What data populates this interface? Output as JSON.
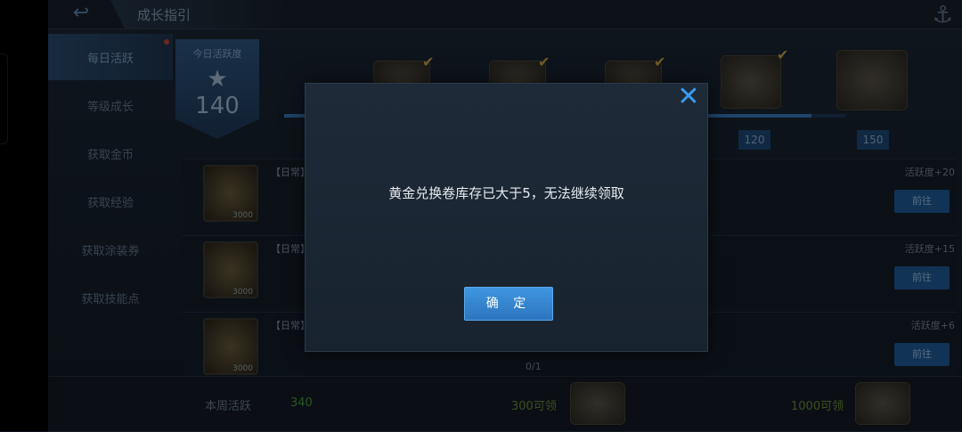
{
  "header": {
    "title": "成长指引",
    "back_icon": "back-arrow-icon",
    "anchor_icon": "anchor-icon"
  },
  "sidebar": {
    "items": [
      {
        "label": "每日活跃",
        "active": true,
        "has_dot": true
      },
      {
        "label": "等级成长",
        "active": false
      },
      {
        "label": "获取金币",
        "active": false
      },
      {
        "label": "获取经验",
        "active": false
      },
      {
        "label": "获取涂装券",
        "active": false
      },
      {
        "label": "获取技能点",
        "active": false
      }
    ]
  },
  "activity": {
    "label": "今日活跃度",
    "value": "140"
  },
  "milestones": [
    "120",
    "150"
  ],
  "tasks": [
    {
      "title": "【日常】",
      "reward": "活跃度+20",
      "button": "前往",
      "qty": "3000"
    },
    {
      "title": "【日常】",
      "reward": "活跃度+15",
      "button": "前往",
      "qty": "3000"
    },
    {
      "title": "【日常】",
      "reward": "活跃度+6",
      "button": "前往",
      "qty": "3000",
      "progress": "0/1"
    }
  ],
  "footer": {
    "week_label": "本周活跃",
    "week_value": "340",
    "tier1": "300可领",
    "tier2": "1000可领"
  },
  "dialog": {
    "message": "黄金兑换卷库存已大于5，无法继续领取",
    "confirm": "确 定",
    "close_icon": "close-icon"
  },
  "colors": {
    "accent": "#3a9bf0",
    "button": "#2d74be"
  }
}
